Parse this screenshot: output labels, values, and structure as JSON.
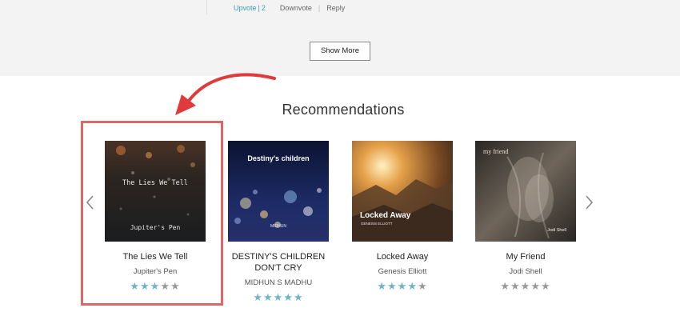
{
  "comment": {
    "upvote_label": "Upvote",
    "upvote_count": "2",
    "downvote_label": "Downvote",
    "reply_label": "Reply"
  },
  "show_more_label": "Show More",
  "section_title": "Recommendations",
  "colors": {
    "accent": "#3aa0b0",
    "star_on": "#6fb5c5",
    "star_off": "#9a9a9a",
    "highlight": "#e06666",
    "arrow": "#e03a3a"
  },
  "books": [
    {
      "title": "The Lies We Tell",
      "author": "Jupiter's Pen",
      "rating": 3,
      "cover_title": "The Lies We Tell",
      "cover_author": "Jupiter's Pen"
    },
    {
      "title_line1": "DESTINY'S CHILDREN",
      "title_line2": "DON'T CRY",
      "author": "MIDHUN S MADHU",
      "rating": 5,
      "cover_title": "Destiny's children",
      "cover_author": "MIDHUN"
    },
    {
      "title": "Locked Away",
      "author": "Genesis Elliott",
      "rating": 4,
      "cover_title": "Locked Away",
      "cover_author": "GENESIS ELLIOTT"
    },
    {
      "title": "My Friend",
      "author": "Jodi Shell",
      "rating": 0,
      "cover_title": "my friend",
      "cover_author": "Jodi Shell"
    }
  ],
  "max_rating": 5
}
